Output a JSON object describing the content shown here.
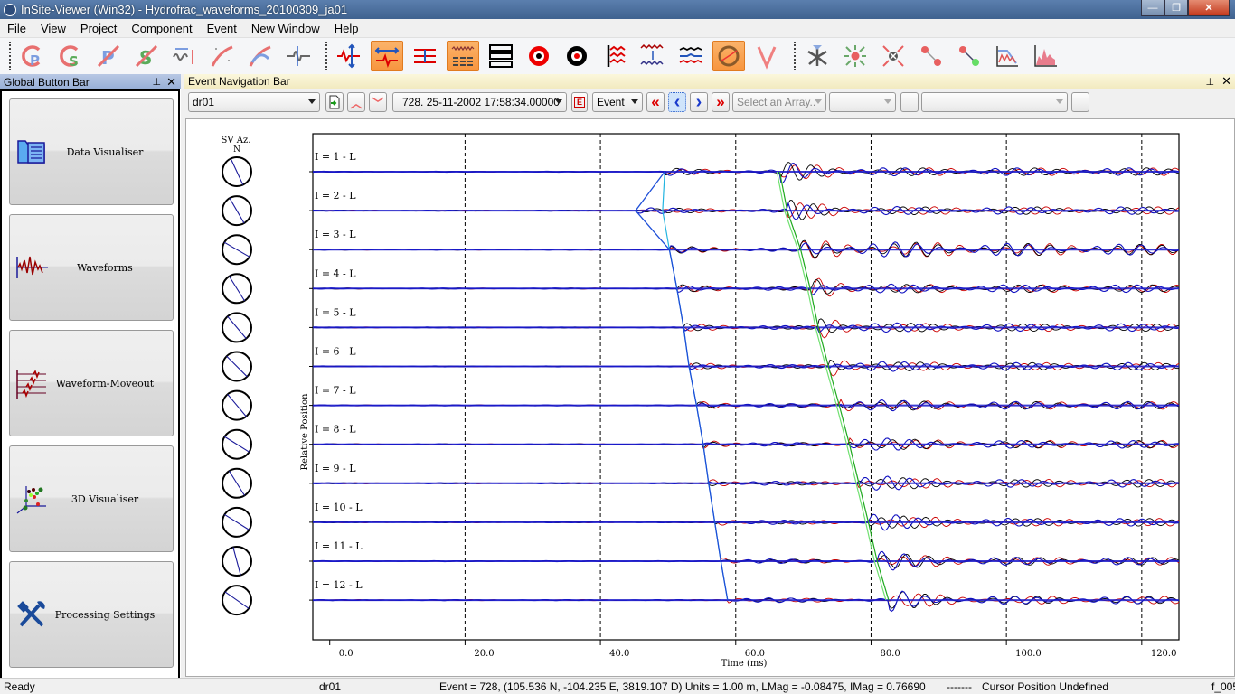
{
  "window": {
    "title": "InSite-Viewer (Win32) - Hydrofrac_waveforms_20100309_ja01",
    "minimize": "—",
    "restore": "❐",
    "close": "✕"
  },
  "menu": [
    "File",
    "View",
    "Project",
    "Component",
    "Event",
    "New Window",
    "Help"
  ],
  "toolbar": {
    "buttons": [
      {
        "name": "pick-p-icon",
        "active": false
      },
      {
        "name": "pick-s-icon",
        "active": false
      },
      {
        "name": "delete-p-pick-icon",
        "active": false
      },
      {
        "name": "delete-s-pick-icon",
        "active": false
      },
      {
        "name": "scale-waveform-icon",
        "active": false
      },
      {
        "name": "moveout-curve-icon",
        "active": false
      },
      {
        "name": "fit-moveout-icon",
        "active": false
      },
      {
        "name": "wavelet-icon",
        "active": false
      },
      {
        "name": "vertical-scale-icon",
        "active": false
      },
      {
        "name": "horizontal-scale-icon",
        "active": true
      },
      {
        "name": "trace-spacing-icon",
        "active": false
      },
      {
        "name": "stacked-traces-icon",
        "active": true
      },
      {
        "name": "list-layout-icon",
        "active": false
      },
      {
        "name": "target-red-icon",
        "active": false
      },
      {
        "name": "target-black-icon",
        "active": false
      },
      {
        "name": "align-traces-icon",
        "active": false
      },
      {
        "name": "compare-traces-icon",
        "active": false
      },
      {
        "name": "three-component-icon",
        "active": false
      },
      {
        "name": "polarity-icon",
        "active": true
      },
      {
        "name": "v-marker-icon",
        "active": false
      },
      {
        "name": "rotate-axes-icon",
        "active": false
      },
      {
        "name": "expand-source-icon",
        "active": false
      },
      {
        "name": "collapse-source-icon",
        "active": false
      },
      {
        "name": "ray-path-icon",
        "active": false
      },
      {
        "name": "ray-path-green-icon",
        "active": false
      },
      {
        "name": "spectrum-decay-icon",
        "active": false
      },
      {
        "name": "spectrum-icon",
        "active": false
      }
    ]
  },
  "left_panel": {
    "title": "Global Button Bar",
    "pin": "📌",
    "close": "✕",
    "buttons": [
      {
        "label": "Data Visualiser",
        "icon": "data-visualiser-icon"
      },
      {
        "label": "Waveforms",
        "icon": "waveforms-icon"
      },
      {
        "label": "Waveform-Moveout",
        "icon": "waveform-moveout-icon"
      },
      {
        "label": "3D Visualiser",
        "icon": "3d-visualiser-icon"
      },
      {
        "label": "Processing Settings",
        "icon": "processing-settings-icon"
      }
    ]
  },
  "nav_panel": {
    "title": "Event Navigation Bar",
    "dataset": "dr01",
    "event_select": "728.  25-11-2002  17:58:34.00000",
    "mode_select": "Event",
    "array_select_placeholder": "Select an Array..",
    "first": "«",
    "prev": "‹",
    "next": "›",
    "last": "»",
    "e_button": "E"
  },
  "plot": {
    "sv_header": "SV Az.",
    "sv_north": "N",
    "ylabel": "Relative Position",
    "xlabel": "Time (ms)",
    "xticks": [
      "0.0",
      "20.0",
      "40.0",
      "60.0",
      "80.0",
      "100.0",
      "120.0"
    ],
    "xrange": [
      -2.5,
      125.5
    ],
    "trace_labels": [
      "I = 1 - L",
      "I = 2 - L",
      "I = 3 - L",
      "I = 4 - L",
      "I = 5 - L",
      "I = 6 - L",
      "I = 7 - L",
      "I = 8 - L",
      "I = 9 - L",
      "I = 10 - L",
      "I = 11 - L",
      "I = 12 - L"
    ],
    "sv_azimuths_deg": [
      155,
      150,
      120,
      148,
      140,
      135,
      140,
      122,
      148,
      122,
      165,
      125
    ],
    "p_picks_ms": [
      49.5,
      45.2,
      50.2,
      51.3,
      52.3,
      53.1,
      54.2,
      55.2,
      56.0,
      56.9,
      57.8,
      58.8
    ],
    "s_picks_ms": [
      66.5,
      67.6,
      69.6,
      71.0,
      72.2,
      73.7,
      75.3,
      76.8,
      78.2,
      79.6,
      80.9,
      82.6
    ],
    "colors": {
      "p_pick": "#1e4fd8",
      "p_model": "#22b4e0",
      "s_pick": "#1ea81e",
      "s_model": "#70e070",
      "trace_x": "#cc0000",
      "trace_y": "#000000",
      "trace_z": "#1010c0"
    }
  },
  "status": {
    "ready": "Ready",
    "dataset": "dr01",
    "event_info": "Event = 728, (105.536 N, -104.235 E, 3819.107 D) Units = 1.00 m, LMag = -0.08475, IMag = 0.76690",
    "dashes": "-------",
    "cursor": "Cursor Position Undefined",
    "file": "f_005"
  }
}
